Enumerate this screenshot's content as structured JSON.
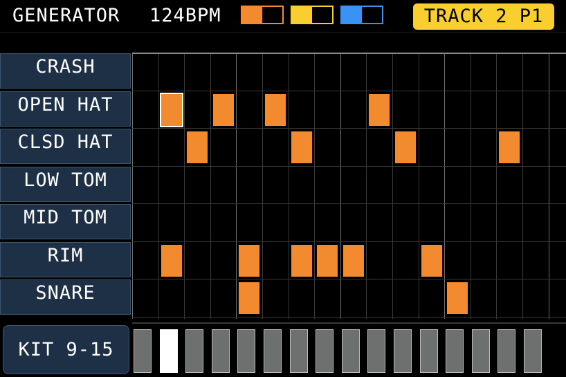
{
  "header": {
    "title": "GENERATOR",
    "bpm": "124BPM",
    "track_badge": "TRACK 2 P1"
  },
  "patterns": [
    {
      "color": "#f28a2f",
      "fill": 0.5
    },
    {
      "color": "#f8cf2f",
      "fill": 0.5
    },
    {
      "color": "#3a93f3",
      "fill": 0.5
    }
  ],
  "rows": [
    {
      "label": "CRASH",
      "steps": []
    },
    {
      "label": "OPEN HAT",
      "steps": [
        1,
        3,
        5,
        9
      ]
    },
    {
      "label": "CLSD HAT",
      "steps": [
        2,
        6,
        10,
        14
      ]
    },
    {
      "label": "LOW TOM",
      "steps": []
    },
    {
      "label": "MID TOM",
      "steps": []
    },
    {
      "label": "RIM",
      "steps": [
        1,
        4,
        6,
        7,
        8,
        11
      ]
    },
    {
      "label": "SNARE",
      "steps": [
        4,
        12
      ]
    }
  ],
  "cursor": {
    "row": 1,
    "step": 1
  },
  "colors": {
    "step_on": "#f28a2f",
    "label_bg": "#1e3046",
    "badge": "#f8cf2f"
  },
  "kit_button": "KIT 9-15",
  "page_steps": {
    "count": 16,
    "active": 1
  }
}
